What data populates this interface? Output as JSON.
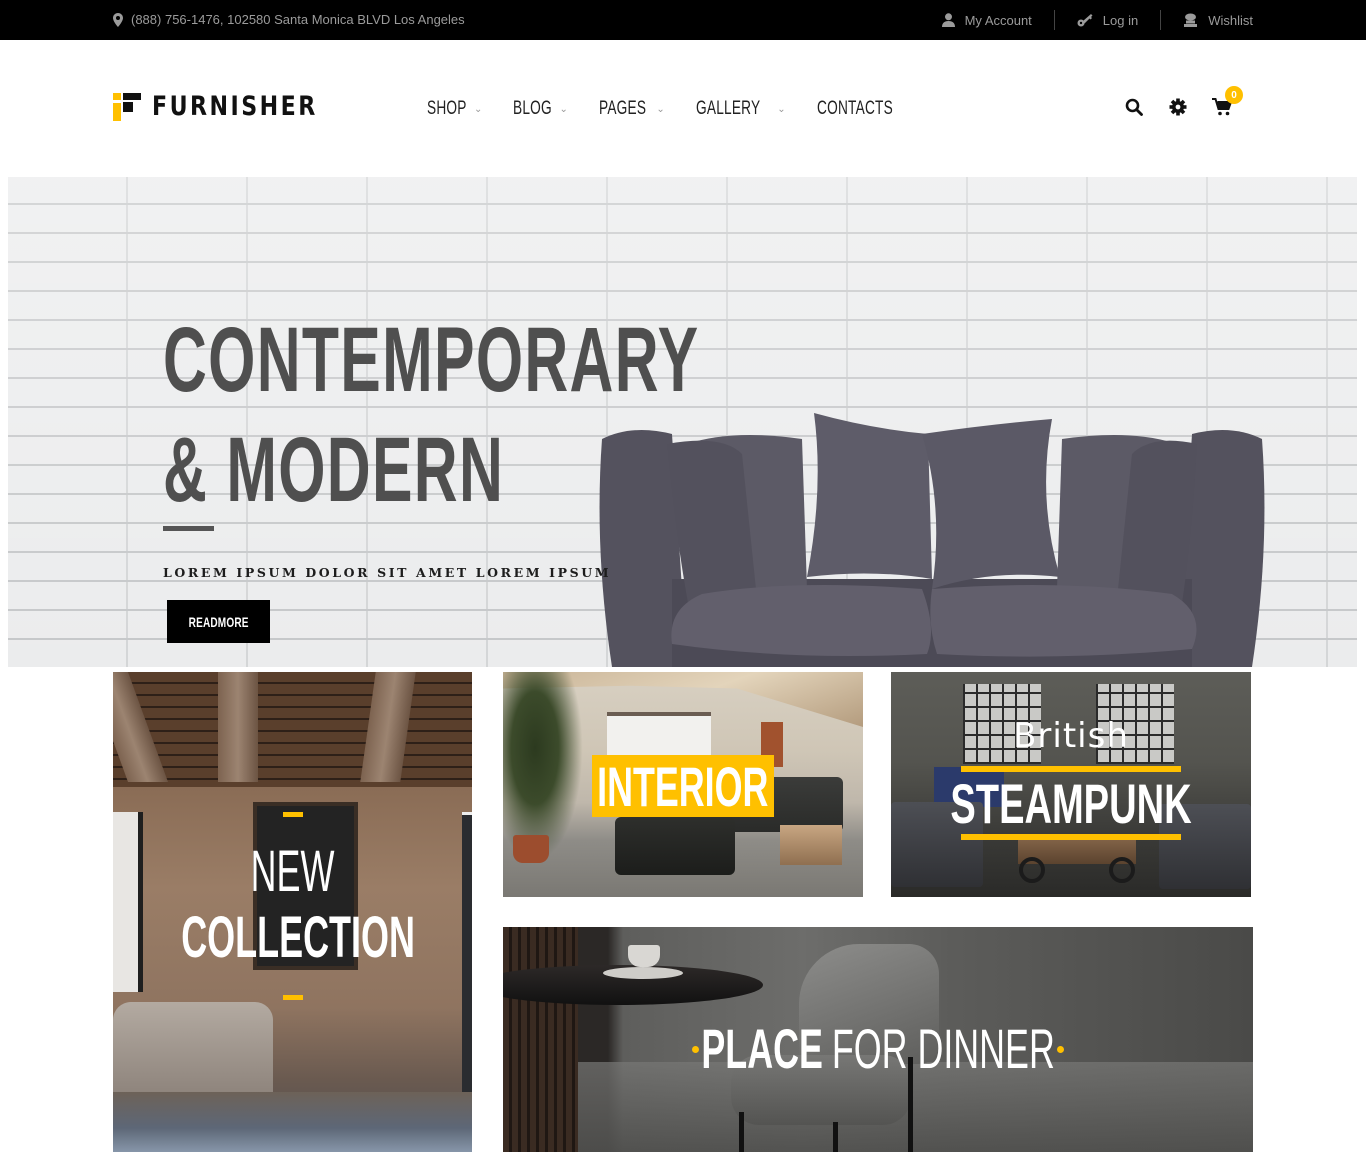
{
  "topbar": {
    "address": "(888) 756-1476, 102580 Santa Monica BLVD Los Angeles",
    "links": [
      {
        "label": "My Account",
        "icon": "user-icon"
      },
      {
        "label": "Log in",
        "icon": "key-icon"
      },
      {
        "label": "Wishlist",
        "icon": "wishlist-icon"
      }
    ]
  },
  "header": {
    "logo_text": "FURNISHER",
    "nav": [
      {
        "label": "SHOP",
        "has_dropdown": true
      },
      {
        "label": "BLOG",
        "has_dropdown": true
      },
      {
        "label": "PAGES",
        "has_dropdown": true
      },
      {
        "label": "GALLERY",
        "has_dropdown": true
      },
      {
        "label": "CONTACTS",
        "has_dropdown": false
      }
    ],
    "icons": [
      "search-icon",
      "gear-icon",
      "cart-icon"
    ],
    "cart_count": "0",
    "chevron_glyph": "⌄"
  },
  "hero": {
    "title_line1": "CONTEMPORARY",
    "title_line2": "& MODERN",
    "subtitle": "LOREM IPSUM DOLOR SIT AMET LOREM IPSUM",
    "button_label": "READMORE"
  },
  "tiles": {
    "collection": {
      "line1": "NEW",
      "line2": "COLLECTION"
    },
    "interior": {
      "label": "INTERIOR"
    },
    "steampunk": {
      "line1": "British",
      "line2": "STEAMPUNK"
    },
    "dinner": {
      "bold": "PLACE",
      "light": "FOR DINNER"
    }
  },
  "colors": {
    "accent": "#ffc000",
    "topbar_bg": "#000000",
    "hero_text": "#4f4f4f"
  }
}
